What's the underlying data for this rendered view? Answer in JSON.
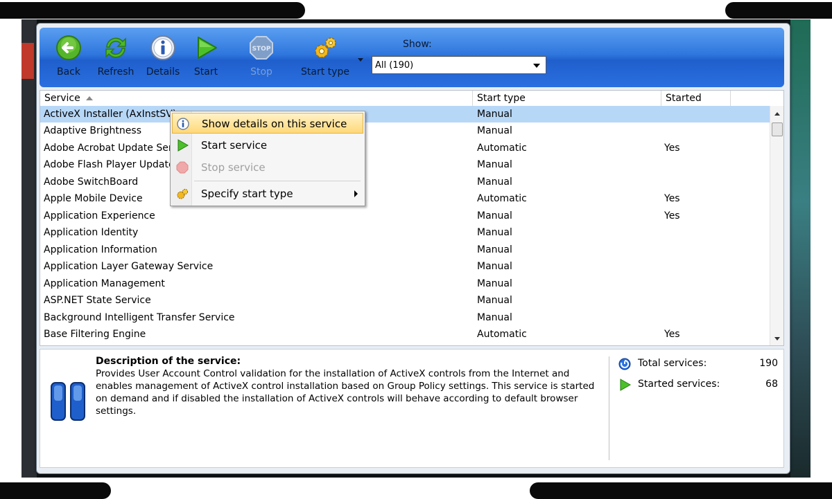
{
  "toolbar": {
    "back_label": "Back",
    "refresh_label": "Refresh",
    "details_label": "Details",
    "start_label": "Start",
    "stop_label": "Stop",
    "start_type_label": "Start type",
    "show_label": "Show:",
    "show_value": "All (190)"
  },
  "table": {
    "headers": {
      "service": "Service",
      "start_type": "Start type",
      "started": "Started"
    },
    "rows": [
      {
        "service": "ActiveX Installer (AxInstSV)",
        "start_type": "Manual",
        "started": ""
      },
      {
        "service": "Adaptive Brightness",
        "start_type": "Manual",
        "started": ""
      },
      {
        "service": "Adobe Acrobat Update Serv",
        "start_type": "Automatic",
        "started": "Yes"
      },
      {
        "service": "Adobe Flash Player Update",
        "start_type": "Manual",
        "started": ""
      },
      {
        "service": "Adobe SwitchBoard",
        "start_type": "Manual",
        "started": ""
      },
      {
        "service": "Apple Mobile Device",
        "start_type": "Automatic",
        "started": "Yes"
      },
      {
        "service": "Application Experience",
        "start_type": "Manual",
        "started": "Yes"
      },
      {
        "service": "Application Identity",
        "start_type": "Manual",
        "started": ""
      },
      {
        "service": "Application Information",
        "start_type": "Manual",
        "started": ""
      },
      {
        "service": "Application Layer Gateway Service",
        "start_type": "Manual",
        "started": ""
      },
      {
        "service": "Application Management",
        "start_type": "Manual",
        "started": ""
      },
      {
        "service": "ASP.NET State Service",
        "start_type": "Manual",
        "started": ""
      },
      {
        "service": "Background Intelligent Transfer Service",
        "start_type": "Manual",
        "started": ""
      },
      {
        "service": "Base Filtering Engine",
        "start_type": "Automatic",
        "started": "Yes"
      }
    ]
  },
  "context_menu": {
    "show_details": "Show details on this service",
    "start_service": "Start service",
    "stop_service": "Stop service",
    "specify_start_type": "Specify start type"
  },
  "description": {
    "title": "Description of the service:",
    "text": "Provides User Account Control validation for the installation of ActiveX controls from the Internet and enables management of ActiveX control installation based on Group Policy settings. This service is started on demand and if disabled the installation of ActiveX controls will behave according to default browser settings."
  },
  "stats": {
    "total_label": "Total services:",
    "total_value": "190",
    "started_label": "Started services:",
    "started_value": "68"
  },
  "colors": {
    "toolbar_blue": "#2f76de",
    "selection": "#b7d7f7",
    "menu_highlight": "#ffd97a"
  },
  "icons": {
    "back": "arrow-left-icon",
    "refresh": "refresh-icon",
    "details": "info-icon",
    "start": "play-icon",
    "stop": "stop-icon",
    "start_type": "gears-icon",
    "service_state": "pause-icon"
  }
}
